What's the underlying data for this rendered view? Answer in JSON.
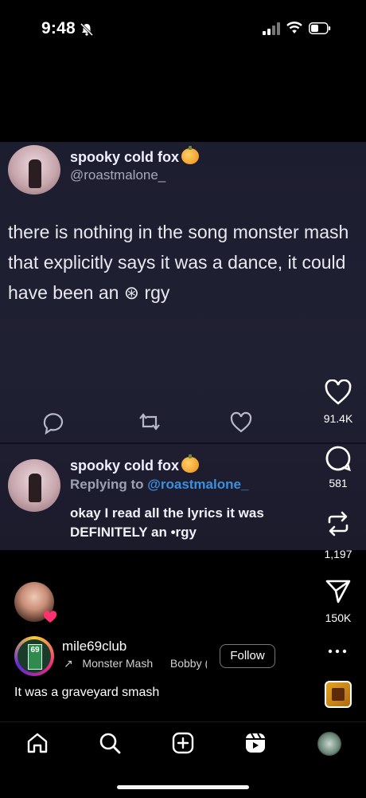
{
  "status_bar": {
    "time": "9:48"
  },
  "tweet": {
    "author_name": "spooky cold fox",
    "author_handle": "@roastmalone_",
    "text": "there is nothing in the song monster mash that explicitly says it was a dance, it could have been an ⊛ rgy",
    "reply": {
      "author_name": "spooky cold fox",
      "replying_prefix": "Replying to ",
      "replying_to": "@roastmalone_",
      "text": "okay I read all the lyrics it was DEFINITELY an •rgy"
    }
  },
  "actions": {
    "likes": "91.4K",
    "comments": "581",
    "reposts": "1,197",
    "shares": "150K"
  },
  "post": {
    "author": "mile69club",
    "audio_title": "Monster Mash",
    "audio_artist": "Bobby (",
    "follow_label": "Follow",
    "caption": "It was a graveyard smash",
    "sign_text": "69"
  },
  "nav": {
    "items": [
      "home-icon",
      "search-icon",
      "create-icon",
      "reels-icon",
      "profile-avatar"
    ]
  }
}
